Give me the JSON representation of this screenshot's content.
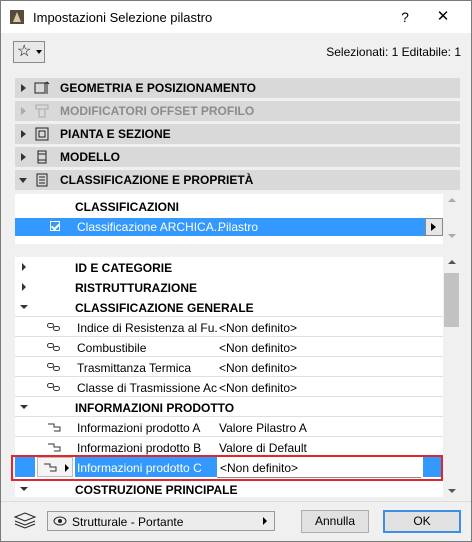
{
  "window": {
    "title": "Impostazioni Selezione pilastro",
    "help_label": "?",
    "close_label": "✕"
  },
  "toolbar": {
    "favorites_icon": "star-icon",
    "selection_info": "Selezionati: 1 Editabile: 1"
  },
  "panels": [
    {
      "label": "GEOMETRIA E POSIZIONAMENTO",
      "icon": "geometry-icon",
      "expanded": false,
      "enabled": true
    },
    {
      "label": "MODIFICATORI OFFSET PROFILO",
      "icon": "profile-offset-icon",
      "expanded": false,
      "enabled": false
    },
    {
      "label": "PIANTA E SEZIONE",
      "icon": "plan-section-icon",
      "expanded": false,
      "enabled": true
    },
    {
      "label": "MODELLO",
      "icon": "model-icon",
      "expanded": false,
      "enabled": true
    },
    {
      "label": "CLASSIFICAZIONE E PROPRIETÀ",
      "icon": "classification-icon",
      "expanded": true,
      "enabled": true
    }
  ],
  "classifications": {
    "heading": "CLASSIFICAZIONI",
    "selected_row": {
      "name": "Classificazione ARCHICA...",
      "value": "Pilastro",
      "checked": true
    }
  },
  "properties": {
    "groups": [
      {
        "label": "ID E CATEGORIE",
        "expanded": false
      },
      {
        "label": "RISTRUTTURAZIONE",
        "expanded": false
      },
      {
        "label": "CLASSIFICAZIONE GENERALE",
        "expanded": true
      },
      {
        "label": "INFORMAZIONI PRODOTTO",
        "expanded": true
      },
      {
        "label": "COSTRUZIONE PRINCIPALE",
        "expanded": true
      }
    ],
    "general_rows": [
      {
        "name": "Indice di Resistenza al Fu...",
        "value": "<Non definito>"
      },
      {
        "name": "Combustibile",
        "value": "<Non definito>"
      },
      {
        "name": "Trasmittanza Termica",
        "value": "<Non definito>"
      },
      {
        "name": "Classe di Trasmissione Ac...",
        "value": "<Non definito>"
      }
    ],
    "product_rows": [
      {
        "name": "Informazioni prodotto A",
        "value": "Valore Pilastro A"
      },
      {
        "name": "Informazioni prodotto B",
        "value": "Valore di Default"
      },
      {
        "name": "Informazioni prodotto C",
        "value": "<Non definito>"
      }
    ]
  },
  "footer": {
    "view_option": "Strutturale - Portante",
    "cancel_label": "Annulla",
    "ok_label": "OK"
  },
  "colors": {
    "selection": "#3399ff",
    "highlight_frame": "#e3262b",
    "panel_header": "#d9d9d9"
  }
}
